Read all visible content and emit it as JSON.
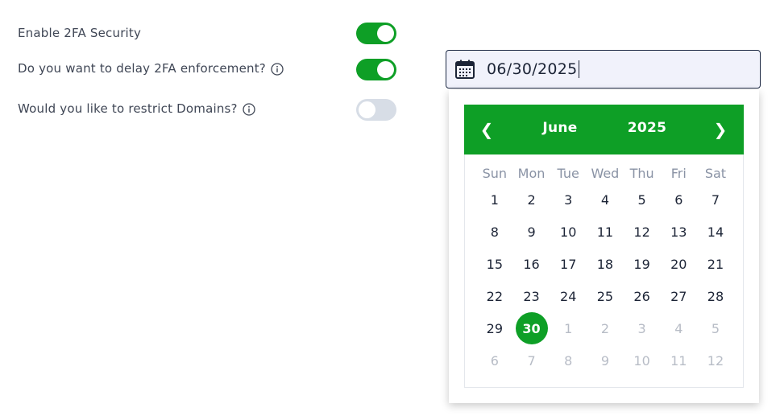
{
  "settings": [
    {
      "label": "Enable 2FA Security",
      "info": false,
      "enabled": true
    },
    {
      "label": "Do you want to delay 2FA enforcement?",
      "info": true,
      "enabled": true
    },
    {
      "label": "Would you like to restrict Domains?",
      "info": true,
      "enabled": false
    }
  ],
  "date_input": {
    "value": "06/30/2025",
    "icon": "calendar-icon"
  },
  "calendar": {
    "month": "June",
    "year": "2025",
    "prev_glyph": "❮",
    "next_glyph": "❯",
    "weekdays": [
      "Sun",
      "Mon",
      "Tue",
      "Wed",
      "Thu",
      "Fri",
      "Sat"
    ],
    "days": [
      {
        "label": "1",
        "muted": false
      },
      {
        "label": "2",
        "muted": false
      },
      {
        "label": "3",
        "muted": false
      },
      {
        "label": "4",
        "muted": false
      },
      {
        "label": "5",
        "muted": false
      },
      {
        "label": "6",
        "muted": false
      },
      {
        "label": "7",
        "muted": false
      },
      {
        "label": "8",
        "muted": false
      },
      {
        "label": "9",
        "muted": false
      },
      {
        "label": "10",
        "muted": false
      },
      {
        "label": "11",
        "muted": false
      },
      {
        "label": "12",
        "muted": false
      },
      {
        "label": "13",
        "muted": false
      },
      {
        "label": "14",
        "muted": false
      },
      {
        "label": "15",
        "muted": false
      },
      {
        "label": "16",
        "muted": false
      },
      {
        "label": "17",
        "muted": false
      },
      {
        "label": "18",
        "muted": false
      },
      {
        "label": "19",
        "muted": false
      },
      {
        "label": "20",
        "muted": false
      },
      {
        "label": "21",
        "muted": false
      },
      {
        "label": "22",
        "muted": false
      },
      {
        "label": "23",
        "muted": false
      },
      {
        "label": "24",
        "muted": false
      },
      {
        "label": "25",
        "muted": false
      },
      {
        "label": "26",
        "muted": false
      },
      {
        "label": "27",
        "muted": false
      },
      {
        "label": "28",
        "muted": false
      },
      {
        "label": "29",
        "muted": false
      },
      {
        "label": "30",
        "muted": false,
        "selected": true
      },
      {
        "label": "1",
        "muted": true
      },
      {
        "label": "2",
        "muted": true
      },
      {
        "label": "3",
        "muted": true
      },
      {
        "label": "4",
        "muted": true
      },
      {
        "label": "5",
        "muted": true
      },
      {
        "label": "6",
        "muted": true
      },
      {
        "label": "7",
        "muted": true
      },
      {
        "label": "8",
        "muted": true
      },
      {
        "label": "9",
        "muted": true
      },
      {
        "label": "10",
        "muted": true
      },
      {
        "label": "11",
        "muted": true
      },
      {
        "label": "12",
        "muted": true
      }
    ]
  },
  "colors": {
    "accent": "#0e9f26",
    "toggle_off": "#d7dde6",
    "muted_day": "#b7bcc6",
    "weekday": "#8a93a5"
  }
}
